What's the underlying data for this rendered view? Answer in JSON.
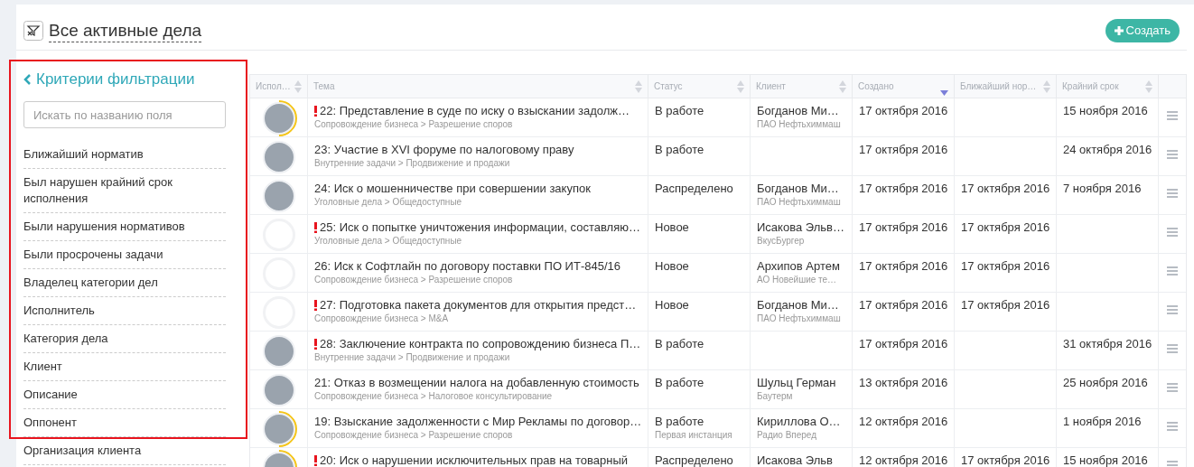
{
  "header": {
    "title": "Все активные дела",
    "create_button": "Создать"
  },
  "filter_panel": {
    "title": "Критерии фильтрации",
    "search": {
      "placeholder": "Искать по названию поля"
    },
    "items": [
      "Ближайший норматив",
      "Был нарушен крайний срок исполнения",
      "Были нарушения нормативов",
      "Были просрочены задачи",
      "Владелец категории дел",
      "Исполнитель",
      "Категория дела",
      "Клиент",
      "Описание",
      "Оппонент",
      "Организация клиента"
    ]
  },
  "table": {
    "columns": [
      {
        "label": "Испол…",
        "sorted": false
      },
      {
        "label": "Тема",
        "sorted": false
      },
      {
        "label": "Статус",
        "sorted": false
      },
      {
        "label": "Клиент",
        "sorted": false
      },
      {
        "label": "Создано",
        "sorted": true
      },
      {
        "label": "Ближайший нор…",
        "sorted": false
      },
      {
        "label": "Крайний срок",
        "sorted": false
      }
    ],
    "rows": [
      {
        "photo": true,
        "ring": true,
        "urgent": true,
        "title": "22: Представление в суде по иску о взыскании задолж…",
        "category": "Сопровождение бизнеса > Разрешение споров",
        "status": "В работе",
        "client": "Богданов Ми…",
        "client_org": "ПАО Нефтьхиммаш",
        "created": "17 октября 2016",
        "nearest": "",
        "deadline": "15 ноября 2016"
      },
      {
        "photo": true,
        "ring": false,
        "urgent": false,
        "title": "23: Участие в XVI форуме по налоговому праву",
        "category": "Внутренние задачи > Продвижение и продажи",
        "status": "В работе",
        "client": "",
        "client_org": "",
        "created": "17 октября 2016",
        "nearest": "",
        "deadline": "24 октября 2016"
      },
      {
        "photo": true,
        "ring": false,
        "urgent": false,
        "title": "24: Иск о мошенничестве при совершении закупок",
        "category": "Уголовные дела > Общедоступные",
        "status": "Распределено",
        "client": "Богданов Ми…",
        "client_org": "ПАО Нефтьхиммаш",
        "created": "17 октября 2016",
        "nearest": "17 октября 2016",
        "deadline": "7 ноября 2016"
      },
      {
        "photo": false,
        "ring": false,
        "urgent": true,
        "title": "25: Иск о попытке уничтожения информации, составляю…",
        "category": "Уголовные дела > Общедоступные",
        "status": "Новое",
        "client": "Исакова Эльв…",
        "client_org": "ВкусБургер",
        "created": "17 октября 2016",
        "nearest": "17 октября 2016",
        "deadline": ""
      },
      {
        "photo": false,
        "ring": false,
        "urgent": false,
        "title": "26: Иск к Софтлайн по договору поставки ПО ИТ-845/16",
        "category": "Сопровождение бизнеса > Разрешение споров",
        "status": "Новое",
        "client": "Архипов Артем",
        "client_org": "АО Новейшие те…",
        "created": "17 октября 2016",
        "nearest": "17 октября 2016",
        "deadline": ""
      },
      {
        "photo": false,
        "ring": false,
        "urgent": true,
        "title": "27: Подготовка пакета документов для открытия предст…",
        "category": "Сопровождение бизнеса > M&A",
        "status": "Новое",
        "client": "Богданов Ми…",
        "client_org": "ПАО Нефтьхиммаш",
        "created": "17 октября 2016",
        "nearest": "17 октября 2016",
        "deadline": ""
      },
      {
        "photo": true,
        "ring": false,
        "urgent": true,
        "title": "28: Заключение контракта по сопровождению бизнеса П…",
        "category": "Внутренние задачи > Продвижение и продажи",
        "status": "В работе",
        "client": "",
        "client_org": "",
        "created": "17 октября 2016",
        "nearest": "",
        "deadline": "31 октября 2016"
      },
      {
        "photo": true,
        "ring": false,
        "urgent": false,
        "title": "21: Отказ в возмещении налога на добавленную стоимость",
        "category": "Сопровождение бизнеса > Налоговое консультирование",
        "status": "В работе",
        "client": "Шульц Герман",
        "client_org": "Баутерм",
        "created": "13 октября 2016",
        "nearest": "",
        "deadline": "25 ноября 2016"
      },
      {
        "photo": true,
        "ring": true,
        "urgent": false,
        "title": "19: Взыскание задолженности с Мир Рекламы по договор…",
        "category": "Сопровождение бизнеса > Разрешение споров",
        "status": "В работе",
        "status_note": "Первая инстанция",
        "client": "Кириллова О…",
        "client_org": "Радио Вперед",
        "created": "12 октября 2016",
        "nearest": "",
        "deadline": "1 ноября 2016"
      },
      {
        "photo": true,
        "ring": true,
        "urgent": true,
        "title": "20: Иск о нарушении исключительных прав на товарный",
        "category": "",
        "status": "Распределено",
        "client": "Исакова Эльв",
        "client_org": "",
        "created": "12 октября 2016",
        "nearest": "17 октября 2016",
        "deadline": "15 ноября 2016"
      }
    ]
  }
}
